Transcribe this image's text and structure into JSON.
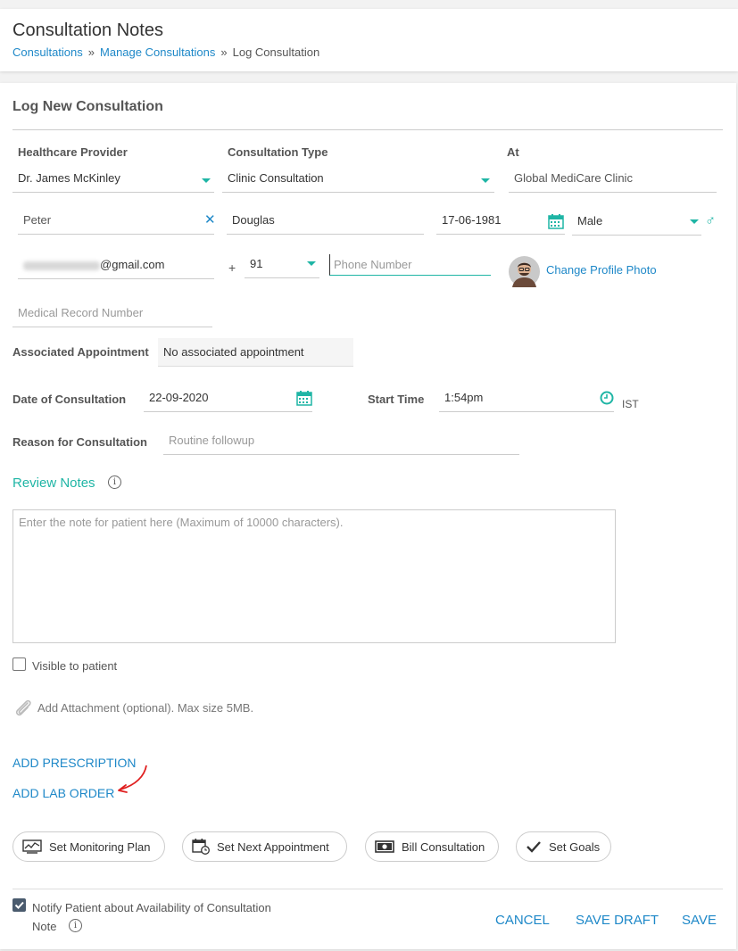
{
  "header": {
    "title": "Consultation Notes",
    "breadcrumb": [
      "Consultations",
      "Manage Consultations",
      "Log Consultation"
    ],
    "separator": "»"
  },
  "form": {
    "section_title": "Log New Consultation",
    "provider": {
      "label": "Healthcare Provider",
      "value": "Dr. James McKinley"
    },
    "consult_type": {
      "label": "Consultation Type",
      "value": "Clinic Consultation"
    },
    "location": {
      "label": "At",
      "value": "Global MediCare Clinic"
    },
    "first_name": "Peter",
    "last_name": "Douglas",
    "dob": "17-06-1981",
    "gender": "Male",
    "email_suffix": "@gmail.com",
    "phone_plus": "+",
    "country_code": "91",
    "phone_placeholder": "Phone Number",
    "change_photo": "Change Profile Photo",
    "mrn_placeholder": "Medical Record Number",
    "appointment": {
      "label": "Associated Appointment",
      "value": "No associated appointment"
    },
    "date": {
      "label": "Date of Consultation",
      "value": "22-09-2020"
    },
    "time": {
      "label": "Start Time",
      "value": "1:54pm",
      "tz": "IST"
    },
    "reason": {
      "label": "Reason for Consultation",
      "placeholder": "Routine followup"
    },
    "review_notes": "Review Notes",
    "note_placeholder": "Enter the note for patient here (Maximum of 10000 characters).",
    "visible_label": "Visible to patient",
    "attachment_label": "Add Attachment (optional). Max size 5MB.",
    "add_prescription": "ADD PRESCRIPTION",
    "add_lab_order": "ADD LAB ORDER"
  },
  "pills": {
    "monitoring": "Set Monitoring Plan",
    "next_appt": "Set Next Appointment",
    "bill": "Bill Consultation",
    "goals": "Set Goals"
  },
  "footer": {
    "notify_line1": "Notify Patient about Availability of Consultation",
    "notify_line2": "Note",
    "cancel": "CANCEL",
    "save_draft": "SAVE DRAFT",
    "save": "SAVE"
  },
  "colors": {
    "accent_teal": "#1fb5a5",
    "link_blue": "#1e88c8",
    "arrow_red": "#e02020"
  },
  "icons": [
    "calendar-icon",
    "clock-icon",
    "clear-icon",
    "male-icon",
    "info-icon",
    "paperclip-icon",
    "chart-icon",
    "calendar-clock-icon",
    "bill-icon",
    "check-icon"
  ]
}
